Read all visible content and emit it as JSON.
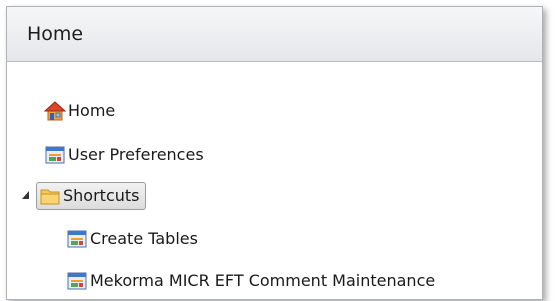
{
  "panel": {
    "title": "Home"
  },
  "tree": {
    "items": [
      {
        "label": "Home",
        "icon": "home-icon"
      },
      {
        "label": "User Preferences",
        "icon": "form-window-icon"
      },
      {
        "label": "Shortcuts",
        "icon": "folder-icon",
        "expanded": true,
        "selected": true
      },
      {
        "label": "Create Tables",
        "icon": "form-window-icon"
      },
      {
        "label": "Mekorma MICR EFT Comment Maintenance",
        "icon": "form-window-icon"
      }
    ]
  }
}
